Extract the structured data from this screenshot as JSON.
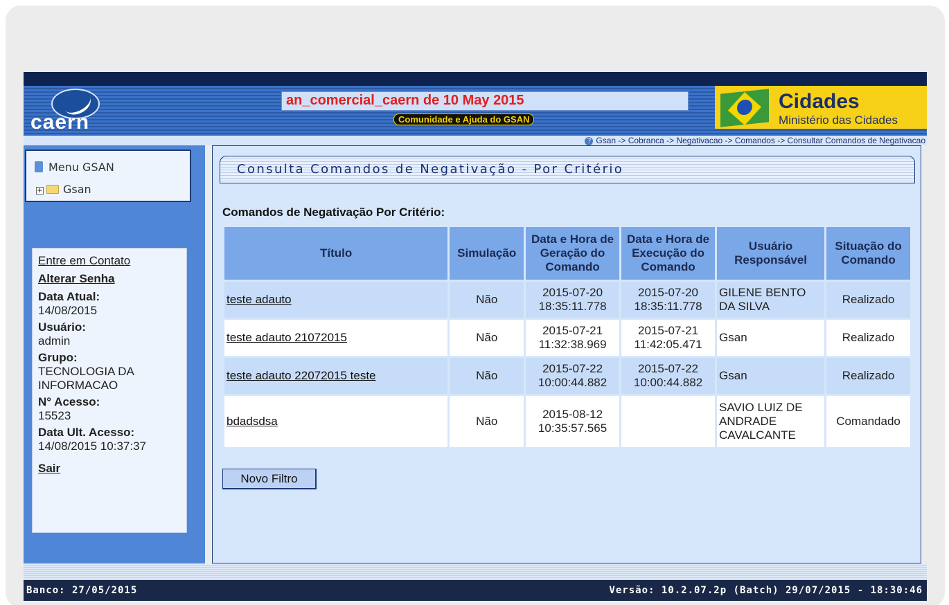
{
  "header": {
    "logo_text": "caern",
    "ticker": "an_comercial_caern de 10 May 2015",
    "help_link": "Comunidade e Ajuda do GSAN",
    "cidades_title": "Cidades",
    "cidades_sub": "Ministério das Cidades"
  },
  "breadcrumb": "Gsan -> Cobranca -> Negativacao -> Comandos -> Consultar Comandos de Negativacao",
  "sidebar": {
    "menu_title": "Menu GSAN",
    "tree_root": "Gsan",
    "entre_contato": "Entre em Contato",
    "alterar_senha": "Alterar Senha",
    "data_atual_label": "Data Atual:",
    "data_atual": "14/08/2015",
    "usuario_label": "Usuário:",
    "usuario": "admin",
    "grupo_label": "Grupo:",
    "grupo": "TECNOLOGIA DA INFORMACAO",
    "acesso_label": "N° Acesso:",
    "acesso": "15523",
    "ult_acesso_label": "Data Ult. Acesso:",
    "ult_acesso": "14/08/2015 10:37:37",
    "sair": "Sair"
  },
  "main": {
    "page_title": "Consulta Comandos de Negativação - Por Critério",
    "section_title": "Comandos de Negativação Por Critério:",
    "columns": [
      "Título",
      "Simulação",
      "Data e Hora de Geração do Comando",
      "Data e Hora de Execução do Comando",
      "Usuário Responsável",
      "Situação do Comando"
    ],
    "rows": [
      {
        "titulo": "teste adauto ",
        "simulacao": "Não",
        "geracao": "2015-07-20 18:35:11.778",
        "execucao": "2015-07-20 18:35:11.778",
        "usuario": "GILENE BENTO DA SILVA",
        "situacao": "Realizado"
      },
      {
        "titulo": "teste adauto 21072015 ",
        "simulacao": "Não",
        "geracao": "2015-07-21 11:32:38.969",
        "execucao": "2015-07-21 11:42:05.471",
        "usuario": "Gsan",
        "situacao": "Realizado"
      },
      {
        "titulo": "teste adauto 22072015 teste ",
        "simulacao": "Não",
        "geracao": "2015-07-22 10:00:44.882",
        "execucao": "2015-07-22 10:00:44.882",
        "usuario": "Gsan",
        "situacao": "Realizado"
      },
      {
        "titulo": "bdadsdsa ",
        "simulacao": "Não",
        "geracao": "2015-08-12 10:35:57.565",
        "execucao": "",
        "usuario": "SAVIO LUIZ DE ANDRADE CAVALCANTE",
        "situacao": "Comandado"
      }
    ],
    "button_novo": "Novo Filtro"
  },
  "footer": {
    "banco": "Banco: 27/05/2015",
    "versao": "Versão: 10.2.07.2p (Batch) 29/07/2015 - 18:30:46"
  }
}
